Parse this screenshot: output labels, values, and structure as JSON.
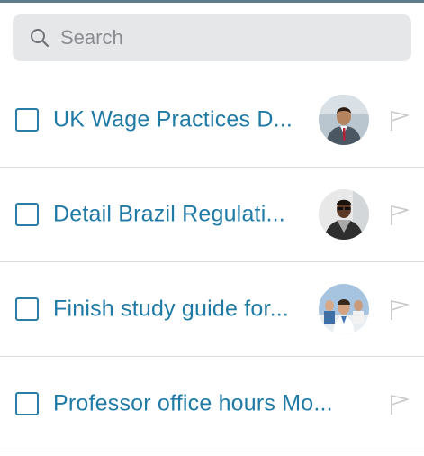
{
  "search": {
    "placeholder": "Search"
  },
  "tasks": [
    {
      "title": "UK Wage Practices D...",
      "avatar": "person-avatar-suit"
    },
    {
      "title": "Detail Brazil Regulati...",
      "avatar": "person-avatar-glasses"
    },
    {
      "title": "Finish study guide for...",
      "avatar": "group-avatar-office"
    },
    {
      "title": "Professor office hours Mo...",
      "avatar": ""
    }
  ],
  "colors": {
    "accent": "#1f7aa6",
    "checkbox": "#2a7da6",
    "search_bg": "#e6e7e9",
    "flag": "#c8c8c8"
  },
  "icons": {
    "search": "search-icon",
    "flag": "flag-icon"
  }
}
